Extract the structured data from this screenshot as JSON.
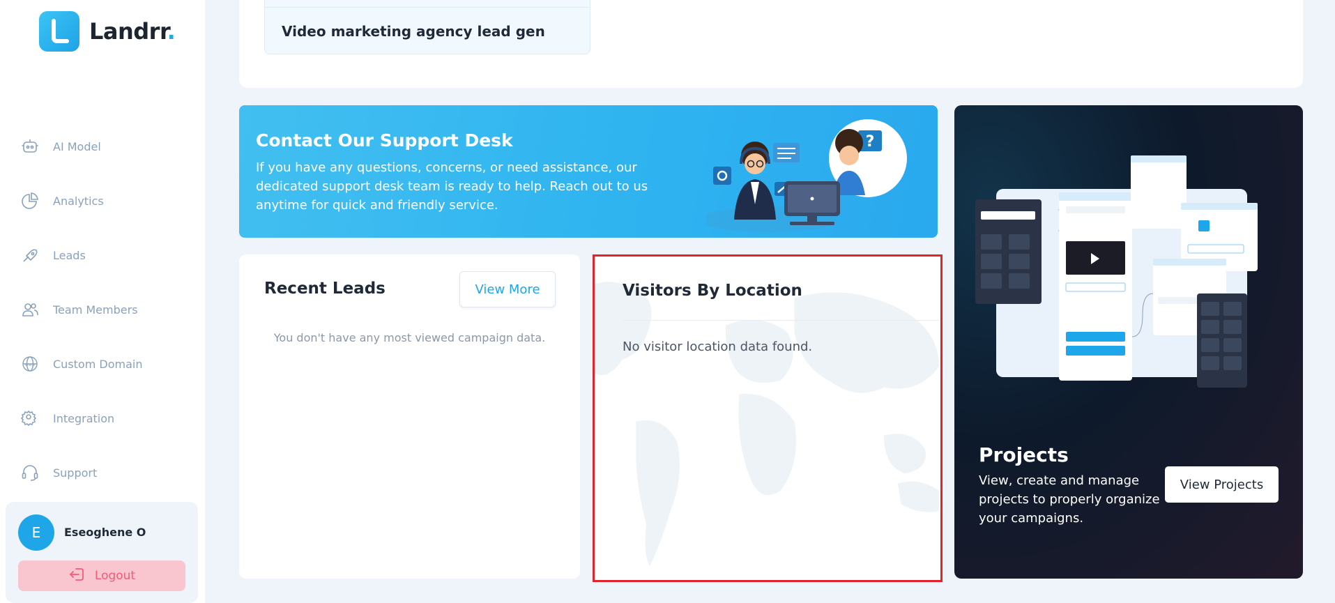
{
  "brand": {
    "name": "Landrr",
    "dot": ".",
    "color": "#20a9ec"
  },
  "sidebar": {
    "items": [
      {
        "label": "AI Model",
        "icon": "robot-icon"
      },
      {
        "label": "Analytics",
        "icon": "pie-chart-icon"
      },
      {
        "label": "Leads",
        "icon": "leads-icon"
      },
      {
        "label": "Team Members",
        "icon": "team-icon"
      },
      {
        "label": "Custom Domain",
        "icon": "globe-www-icon"
      },
      {
        "label": "Integration",
        "icon": "gear-integration-icon"
      },
      {
        "label": "Support",
        "icon": "headset-icon"
      }
    ],
    "user": {
      "initial": "E",
      "name": "Eseoghene O"
    },
    "logout_label": "Logout"
  },
  "top_card": {
    "campaign_title": "Video marketing agency lead gen"
  },
  "support": {
    "title": "Contact Our Support Desk",
    "text": "If you have any questions, concerns, or need assistance, our dedicated support desk team is ready to help. Reach out to us anytime for quick and friendly service."
  },
  "recent_leads": {
    "title": "Recent Leads",
    "view_more": "View More",
    "empty": "You don't have any most viewed campaign data."
  },
  "visitors": {
    "title": "Visitors By Location",
    "empty": "No visitor location data found."
  },
  "projects": {
    "title": "Projects",
    "text": "View, create and manage projects to properly organize your campaigns.",
    "button": "View Projects"
  }
}
